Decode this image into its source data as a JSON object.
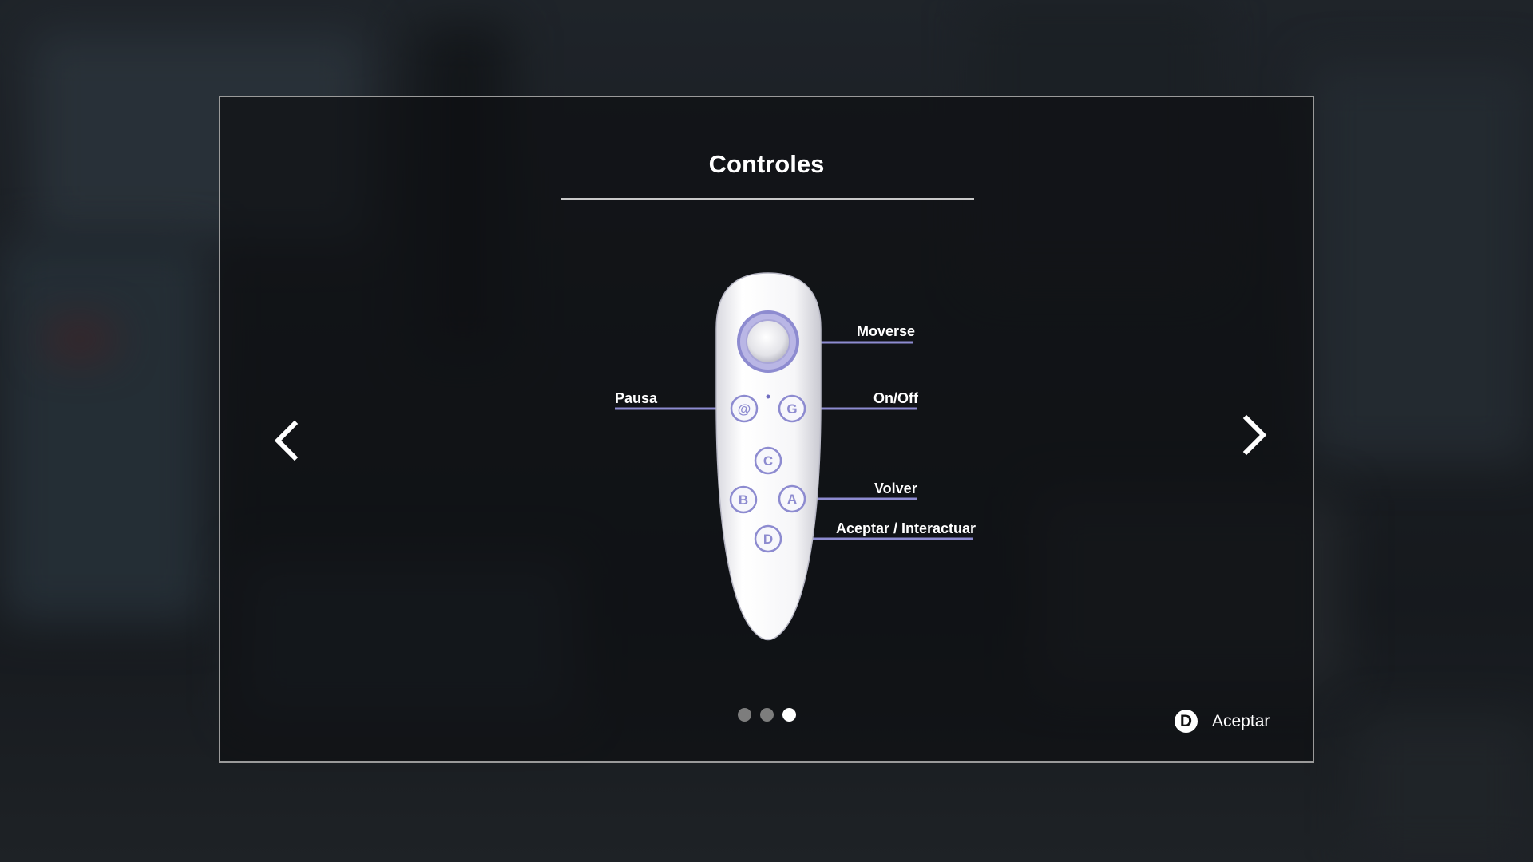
{
  "dialog": {
    "title": "Controles",
    "nav": {
      "prev_icon": "chevron-left-icon",
      "next_icon": "chevron-right-icon"
    },
    "remote": {
      "button_glyphs": {
        "pause": "@",
        "power": "G",
        "c": "C",
        "b": "B",
        "a": "A",
        "d": "D"
      },
      "callouts": {
        "move": "Moverse",
        "pause": "Pausa",
        "power": "On/Off",
        "back": "Volver",
        "accept": "Aceptar / Interactuar"
      }
    },
    "pagination": {
      "total": 3,
      "current": 3
    },
    "footer": {
      "accept_key": "D",
      "accept_label": "Aceptar"
    }
  },
  "colors": {
    "accent": "#8d8bd0",
    "panel_border": "#9a9a9a",
    "text": "#ffffff"
  }
}
